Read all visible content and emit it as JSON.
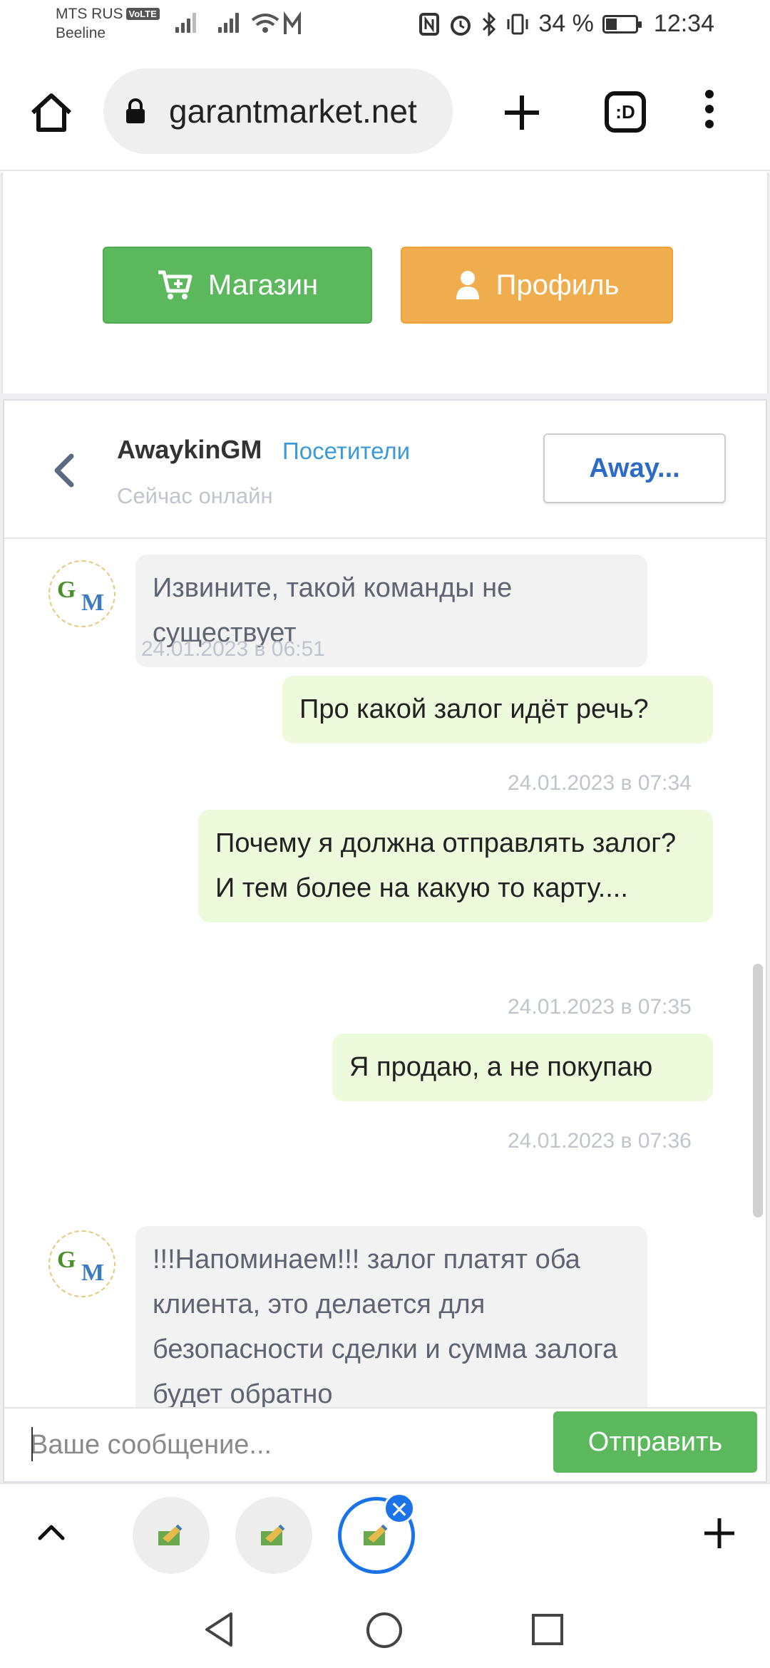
{
  "status_bar": {
    "carrier_1": "MTS RUS",
    "volte": "VoLTE",
    "carrier_2": "Beeline",
    "battery": "34 %",
    "time": "12:34"
  },
  "browser": {
    "url": "garantmarket.net",
    "tabs_label": ":D",
    "icons": [
      "home-icon",
      "lock-icon",
      "plus-icon",
      "tab-switcher-icon",
      "more-vertical-icon"
    ]
  },
  "header_buttons": {
    "shop": "Магазин",
    "profile": "Профиль",
    "colors": {
      "shop": "#5cb85c",
      "profile": "#f0ad4e"
    }
  },
  "chat": {
    "name": "AwaykinGM",
    "group": "Посетители",
    "status": "Сейчас онлайн",
    "action_button": "Away...",
    "messages": [
      {
        "direction": "in",
        "text": "Извините, такой команды не существует",
        "time": "24.01.2023 в 06:51"
      },
      {
        "direction": "out",
        "text": "Про какой залог идёт речь?",
        "time": "24.01.2023 в 07:34"
      },
      {
        "direction": "out",
        "text": "Почему я должна отправлять залог? И тем более на какую то карту....",
        "time": "24.01.2023 в 07:35"
      },
      {
        "direction": "out",
        "text": "Я продаю, а не покупаю",
        "time": "24.01.2023 в 07:36"
      },
      {
        "direction": "in",
        "text": "!!!Напоминаем!!! залог платят оба клиента, это делается для безопасности сделки и сумма залога будет обратно"
      }
    ],
    "avatar_text": [
      "G",
      "M"
    ],
    "input_placeholder": "Ваше сообщение...",
    "send_label": "Отправить",
    "colors": {
      "incoming_bubble": "#f2f2f3",
      "outgoing_bubble": "#edfadc",
      "accent": "#3a9ad9"
    }
  },
  "tab_bar": {
    "close_label": "✕",
    "icons": [
      "chevron-up-icon",
      "tab-thumbnail-icon",
      "close-icon",
      "plus-icon"
    ]
  },
  "nav_bar": {
    "icons": [
      "back-triangle-icon",
      "home-circle-icon",
      "recents-square-icon"
    ]
  }
}
